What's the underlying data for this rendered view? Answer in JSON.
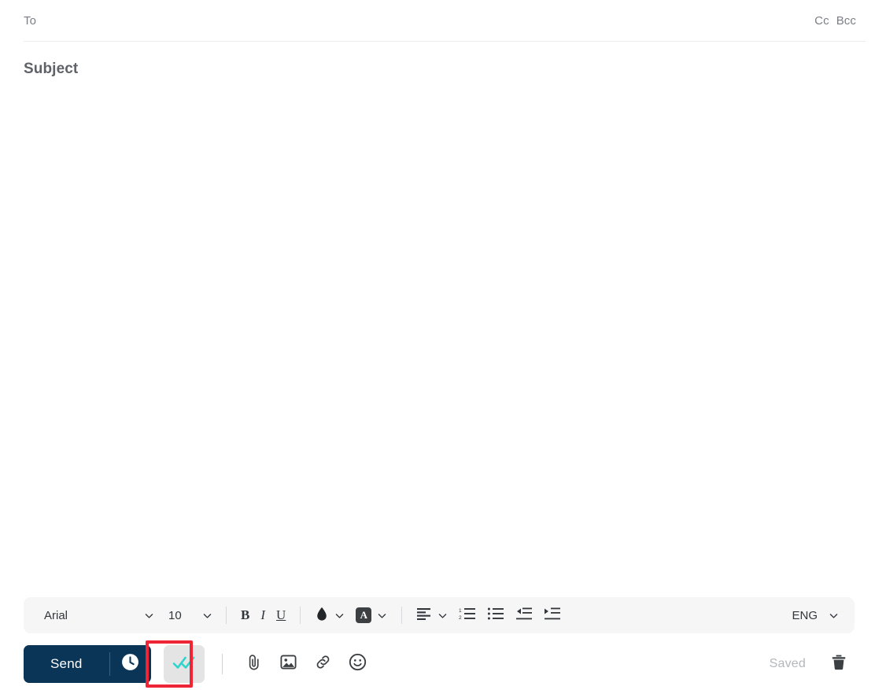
{
  "compose": {
    "to": {
      "placeholder": "To",
      "value": ""
    },
    "cc_label": "Cc",
    "bcc_label": "Bcc",
    "subject": {
      "placeholder": "Subject",
      "value": ""
    },
    "body": {
      "value": ""
    }
  },
  "format_toolbar": {
    "font_family": "Arial",
    "font_size": "10",
    "bold_label": "B",
    "italic_label": "I",
    "underline_label": "U",
    "highlight_label": "A",
    "language": "ENG"
  },
  "actions": {
    "send_label": "Send",
    "saved_label": "Saved"
  },
  "colors": {
    "send_navy": "#0b3557",
    "annotation_red": "#ef2434",
    "read_receipt_teal": "#2dd4cb",
    "toolbar_bg": "#f6f6f7",
    "readreceipt_bg": "#e4e4e4"
  }
}
